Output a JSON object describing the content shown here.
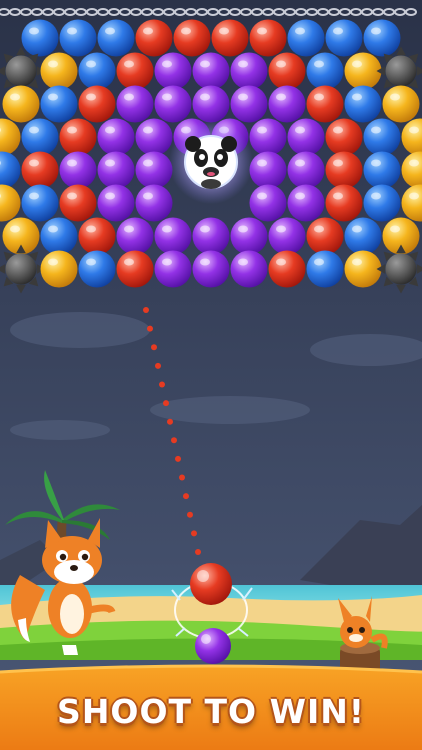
{
  "promo": {
    "banner_text": "SHOOT TO WIN!"
  },
  "colors": {
    "blue": "#2d6fe0",
    "red": "#e3361f",
    "yellow": "#f2b21a",
    "purple": "#8a2be2",
    "sky_top": "#2a3248",
    "sky_bottom": "#4a5672",
    "banner": "#f28a1c",
    "sea": "#5fd0d9",
    "sand": "#f5d58a",
    "grass": "#7bd33b"
  },
  "board": {
    "boss": "panda-boss",
    "hazards": [
      "spiked-ball",
      "spiked-ball",
      "spiked-ball",
      "spiked-ball"
    ]
  },
  "shooter": {
    "current_bubble": "red",
    "next_bubble": "purple"
  },
  "characters": [
    "fox-mascot",
    "small-fox-on-stump"
  ]
}
